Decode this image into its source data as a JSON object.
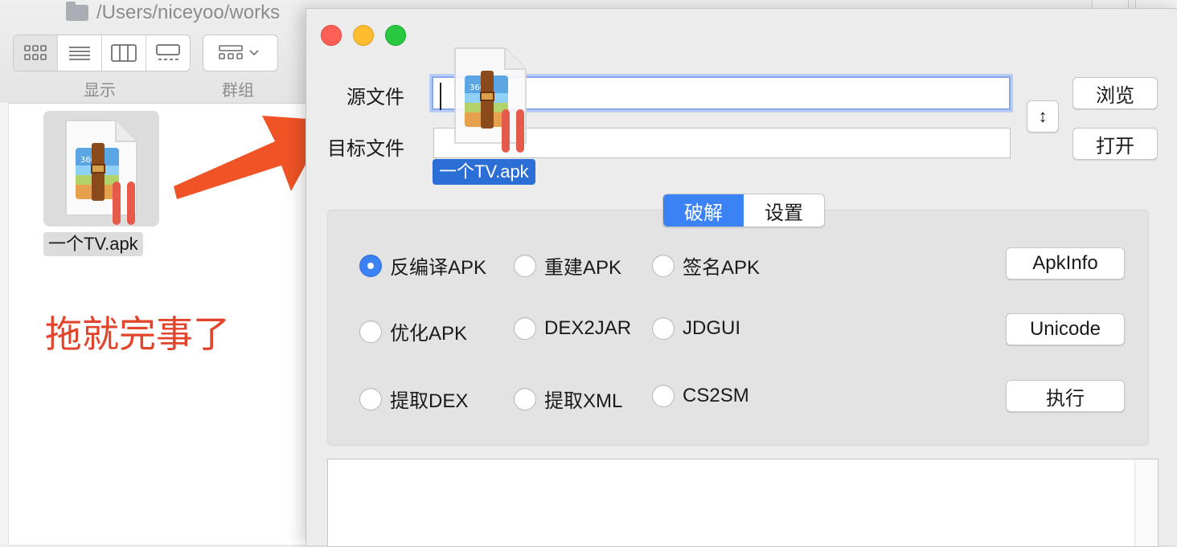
{
  "finder": {
    "path": "/Users/niceyoo/works",
    "toolbar": {
      "display_label": "显示",
      "group_label": "群组"
    },
    "file": {
      "name": "一个TV.apk"
    }
  },
  "annotation": {
    "text": "拖就完事了"
  },
  "app": {
    "source_label": "源文件",
    "target_label": "目标文件",
    "source_value": "",
    "target_value": "",
    "swap_label": "↕",
    "browse_label": "浏览",
    "open_label": "打开",
    "tabs": [
      {
        "label": "破解",
        "active": true
      },
      {
        "label": "设置",
        "active": false
      }
    ],
    "options": [
      {
        "label": "反编译APK",
        "selected": true
      },
      {
        "label": "重建APK",
        "selected": false
      },
      {
        "label": "签名APK",
        "selected": false
      },
      {
        "label": "优化APK",
        "selected": false
      },
      {
        "label": "DEX2JAR",
        "selected": false
      },
      {
        "label": "JDGUI",
        "selected": false
      },
      {
        "label": "提取DEX",
        "selected": false
      },
      {
        "label": "提取XML",
        "selected": false
      },
      {
        "label": "CS2SM",
        "selected": false
      }
    ],
    "buttons": {
      "apkinfo": "ApkInfo",
      "unicode": "Unicode",
      "execute": "执行"
    }
  },
  "drag": {
    "label": "一个TV.apk"
  },
  "colors": {
    "accent": "#3a82f6",
    "annotation": "#e2452b",
    "arrow": "#ef5326"
  }
}
